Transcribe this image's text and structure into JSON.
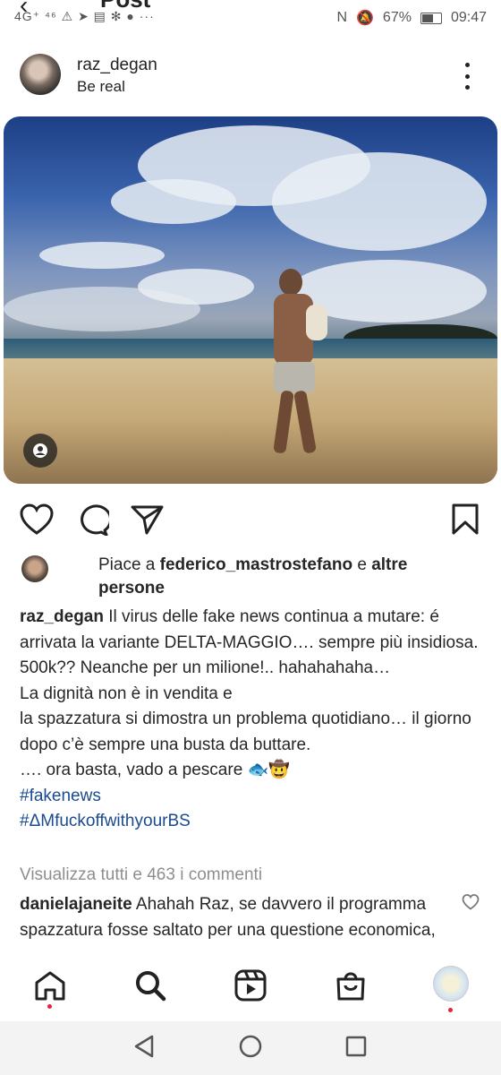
{
  "status_bar": {
    "left_icons": "4G⁺ ⁴⁶ ⚠ ➤ ▤ ✻ ●  ···",
    "nfc": "N",
    "battery": "67%",
    "battery_level": 0.67,
    "time": "09:47"
  },
  "app_bar": {
    "title": "Post"
  },
  "post": {
    "username": "raz_degan",
    "subtitle": "Be real",
    "likes": {
      "prefix": "Piace a ",
      "liker": "federico_mastrostefano",
      "connector": " e ",
      "others": "altre persone"
    },
    "caption": {
      "username": "raz_degan",
      "lines": [
        "Il virus delle fake news continua a mutare: é arrivata la variante DELTA-MAGGIO…. sempre più insidiosa. 500k?? Neanche per un milione!.. hahahahaha…",
        "La dignità non è in vendita e",
        "la spazzatura si dimostra un  problema quotidiano… il giorno dopo c’è sempre una busta da buttare.",
        "…. ora basta, vado a pescare 🐟🤠"
      ],
      "hashtags": [
        "#fakenews",
        "#ΔMfuckoffwithyourBS"
      ]
    },
    "view_comments": "Visualizza tutti e 463 i commenti",
    "comment": {
      "username": "danielajaneite",
      "text": "Ahahah Raz, se davvero il programma spazzatura fosse saltato per una questione economica, avrebbero anticipato"
    }
  },
  "icons": {
    "like": "heart-icon",
    "comment": "comment-icon",
    "share": "send-icon",
    "save": "bookmark-icon",
    "tag": "person-tag-icon"
  },
  "colors": {
    "hashtag": "#1b4a8f",
    "muted": "#8e8e8e",
    "notification": "#e0243c"
  }
}
